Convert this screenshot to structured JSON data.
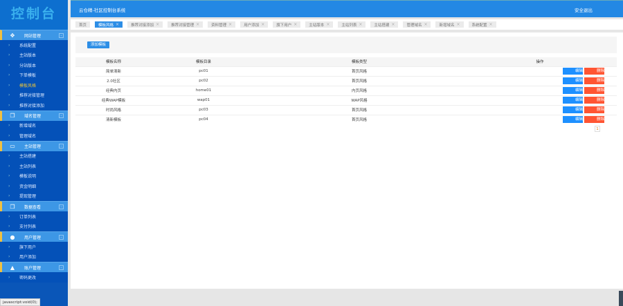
{
  "logo": "控制台",
  "header": {
    "title": "云仓精-社区控制台系统",
    "logout": "安全退出"
  },
  "sidebar": [
    {
      "label": "网站管理",
      "icon": "gear-icon",
      "items": [
        "系统配置",
        "主站版本",
        "分站版本",
        "下单模板",
        "模板风格",
        "推荐对接管理",
        "推荐对接添加"
      ],
      "active": 4
    },
    {
      "label": "域名管理",
      "icon": "copy-icon",
      "items": [
        "新增域名",
        "管理域名"
      ]
    },
    {
      "label": "主站管理",
      "icon": "monitor-icon",
      "items": [
        "主站搭建",
        "主站列表",
        "模板说明",
        "资金明细",
        "提现管理"
      ]
    },
    {
      "label": "数据查看",
      "icon": "copy-icon",
      "items": [
        "订单列表",
        "支付列表"
      ]
    },
    {
      "label": "用户管理",
      "icon": "location-icon",
      "items": [
        "旗下用户",
        "用户添加"
      ]
    },
    {
      "label": "账户管理",
      "icon": "user-icon",
      "items": [
        "密码更改"
      ]
    }
  ],
  "tabs": [
    "首页",
    "模板风格",
    "推荐对接添加",
    "推荐对接管理",
    "资料管理",
    "用户添加",
    "旗下用户",
    "主站版本",
    "主站列表",
    "主站搭建",
    "管理域名",
    "新增域名",
    "系统配置"
  ],
  "active_tab": 1,
  "toolbar": {
    "add": "添加模板"
  },
  "table": {
    "headers": [
      "模板名称",
      "模板目录",
      "模板类型",
      "操作"
    ],
    "rows": [
      [
        "简单清新",
        "pc01",
        "首页风格"
      ],
      [
        "2.0社区",
        "pc02",
        "首页风格"
      ],
      [
        "经典内页",
        "home01",
        "内页风格"
      ],
      [
        "经典WAP模板",
        "wap01",
        "WAP风格"
      ],
      [
        "时尚风格",
        "pc03",
        "首页风格"
      ],
      [
        "清新模板",
        "pc04",
        "首页风格"
      ]
    ],
    "edit": "编辑",
    "delete": "删除"
  },
  "pager": "1",
  "status_bar": "javascript:void(0);"
}
